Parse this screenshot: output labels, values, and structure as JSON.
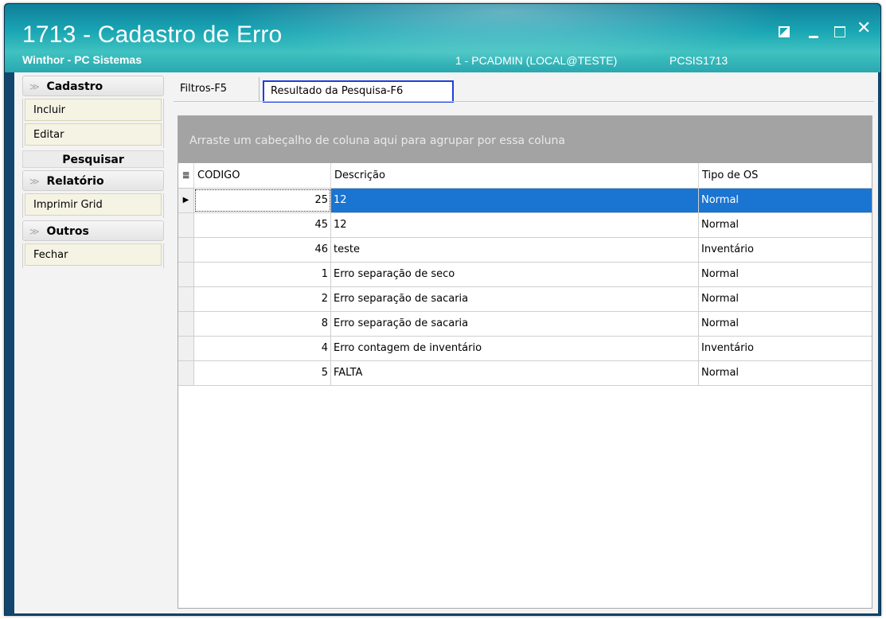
{
  "window": {
    "title": "1713 - Cadastro de Erro",
    "subtitle": "Winthor - PC Sistemas",
    "user": "1 - PCADMIN (LOCAL@TESTE)",
    "program": "PCSIS1713",
    "controls": {
      "restore_icon": "restore-icon",
      "minimize_icon": "minimize-icon",
      "maximize_icon": "maximize-icon",
      "close_glyph": "✕"
    }
  },
  "sidebar": {
    "cadastro": {
      "label": "Cadastro",
      "chevron": "≫",
      "items": [
        "Incluir",
        "Editar"
      ]
    },
    "pesquisar": {
      "label": "Pesquisar"
    },
    "relatorio": {
      "label": "Relatório",
      "chevron": "≫",
      "items": [
        "Imprimir Grid"
      ]
    },
    "outros": {
      "label": "Outros",
      "chevron": "≫",
      "items": [
        "Fechar"
      ]
    }
  },
  "tabs": [
    {
      "label": "Filtros-F5",
      "active": false
    },
    {
      "label": "Resultado da Pesquisa-F6",
      "active": true
    }
  ],
  "grid": {
    "group_panel_text": "Arraste um cabeçalho de coluna aqui para agrupar por essa coluna",
    "column_chooser_glyph": "≣",
    "columns": [
      "CODIGO",
      "Descrição",
      "Tipo de OS"
    ],
    "current_row_glyph": "▶",
    "rows": [
      {
        "codigo": "25",
        "descricao": "12",
        "tipo": "Normal"
      },
      {
        "codigo": "45",
        "descricao": "12",
        "tipo": "Normal"
      },
      {
        "codigo": "46",
        "descricao": "teste",
        "tipo": "Inventário"
      },
      {
        "codigo": "1",
        "descricao": "Erro separação de seco",
        "tipo": "Normal"
      },
      {
        "codigo": "2",
        "descricao": "Erro separação de sacaria",
        "tipo": "Normal"
      },
      {
        "codigo": "8",
        "descricao": "Erro separação de sacaria",
        "tipo": "Normal"
      },
      {
        "codigo": "4",
        "descricao": "Erro contagem de inventário",
        "tipo": "Inventário"
      },
      {
        "codigo": "5",
        "descricao": "FALTA",
        "tipo": "Normal"
      }
    ],
    "selected_row": 0
  },
  "colors": {
    "titlebar": "#1aa6b4",
    "selection": "#1a74d1",
    "active_tab_border": "#1d3fe0",
    "group_panel": "#a3a3a3"
  }
}
